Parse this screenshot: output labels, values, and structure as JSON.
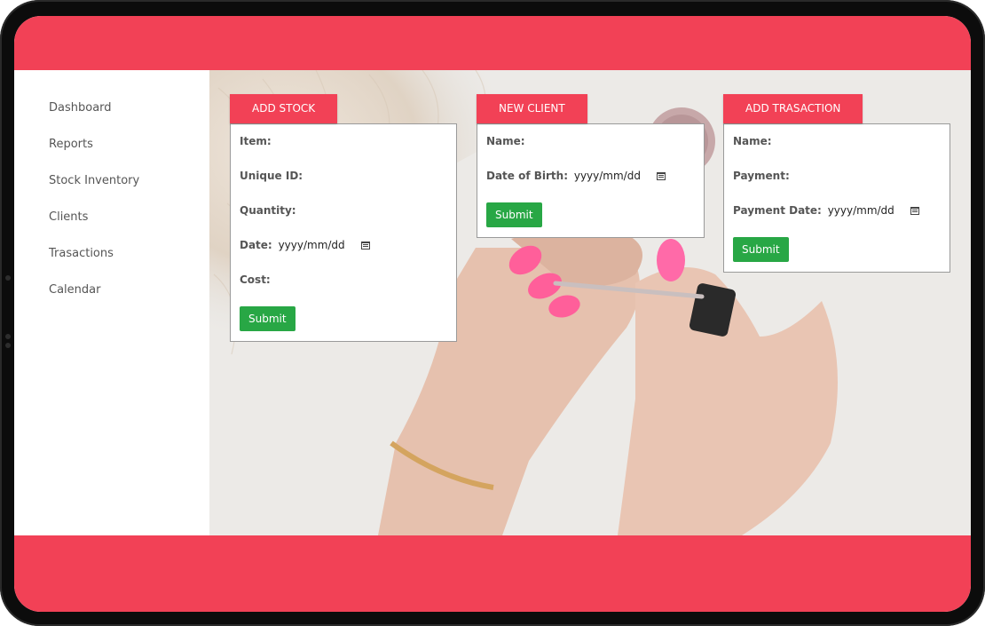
{
  "sidebar": {
    "items": [
      {
        "label": "Dashboard"
      },
      {
        "label": "Reports"
      },
      {
        "label": "Stock Inventory"
      },
      {
        "label": "Clients"
      },
      {
        "label": "Trasactions"
      },
      {
        "label": "Calendar"
      }
    ]
  },
  "forms": {
    "add_stock": {
      "title": "ADD STOCK",
      "item_label": "Item:",
      "unique_id_label": "Unique ID:",
      "quantity_label": "Quantity:",
      "date_label": "Date:",
      "date_placeholder": "yyyy/mm/dd",
      "cost_label": "Cost:",
      "submit_label": "Submit"
    },
    "new_client": {
      "title": "NEW CLIENT",
      "name_label": "Name:",
      "dob_label": "Date of Birth:",
      "dob_placeholder": "yyyy/mm/dd",
      "submit_label": "Submit"
    },
    "add_transaction": {
      "title": "ADD TRASACTION",
      "name_label": "Name:",
      "payment_label": "Payment:",
      "payment_date_label": "Payment Date:",
      "payment_date_placeholder": "yyyy/mm/dd",
      "submit_label": "Submit"
    }
  },
  "colors": {
    "accent": "#f24156",
    "submit": "#28a745"
  },
  "icons": {
    "date_picker": "calendar-icon"
  }
}
